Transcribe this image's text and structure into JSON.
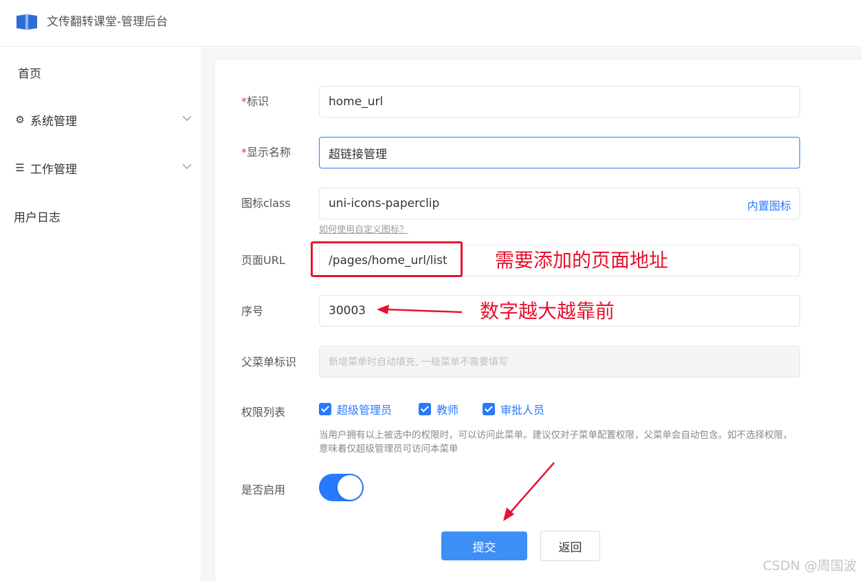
{
  "app": {
    "title": "文传翻转课堂-管理后台",
    "logo_icon": "book-icon",
    "brand_color": "#2979ff"
  },
  "sidebar": {
    "items": [
      {
        "label": "首页",
        "icon": ""
      },
      {
        "label": "系统管理",
        "icon": "gear-icon",
        "expandable": true
      },
      {
        "label": "工作管理",
        "icon": "list-icon",
        "expandable": true
      },
      {
        "label": "用户日志",
        "icon": ""
      }
    ]
  },
  "form": {
    "required_mark": "*",
    "fields": {
      "id": {
        "label": "标识",
        "value": "home_url"
      },
      "name": {
        "label": "显示名称",
        "value": "超链接管理"
      },
      "icon": {
        "label": "图标class",
        "value": "uni-icons-paperclip",
        "suffix_link": "内置图标",
        "help_link": "如何使用自定义图标？"
      },
      "url": {
        "label": "页面URL",
        "value": "/pages/home_url/list"
      },
      "sort": {
        "label": "序号",
        "value": "30003"
      },
      "parent": {
        "label": "父菜单标识",
        "placeholder": "新增菜单时自动填充, 一级菜单不需要填写"
      },
      "permissions": {
        "label": "权限列表",
        "options": [
          "超级管理员",
          "教师",
          "审批人员"
        ],
        "hint": "当用户拥有以上被选中的权限时，可以访问此菜单。建议仅对子菜单配置权限，父菜单会自动包含。如不选择权限，意味着仅超级管理员可访问本菜单"
      },
      "enable": {
        "label": "是否启用",
        "enabled": true
      }
    },
    "buttons": {
      "submit": "提交",
      "back": "返回"
    }
  },
  "annotations": {
    "url_note": "需要添加的页面地址",
    "sort_note": "数字越大越靠前",
    "color": "#e8112d"
  },
  "watermark": "CSDN @周国波"
}
